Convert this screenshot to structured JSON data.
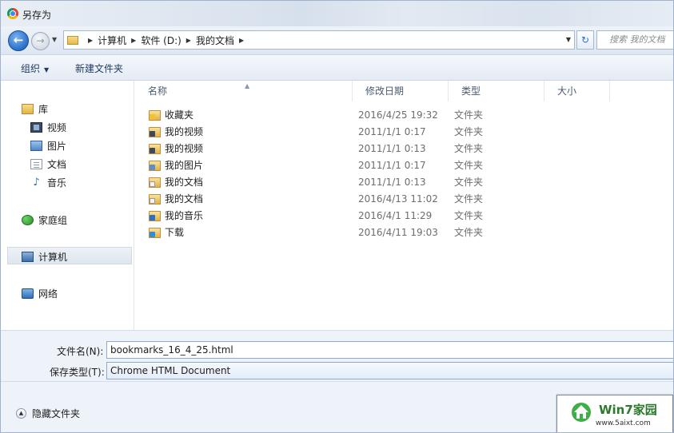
{
  "window": {
    "title": "另存为"
  },
  "navbar": {
    "breadcrumb": [
      "计算机",
      "软件 (D:)",
      "我的文档"
    ],
    "search_placeholder": "搜索 我的文档"
  },
  "toolbar": {
    "organize_label": "组织",
    "new_folder_label": "新建文件夹"
  },
  "sidebar": {
    "library": {
      "label": "库",
      "items": [
        {
          "label": "视频"
        },
        {
          "label": "图片"
        },
        {
          "label": "文档"
        },
        {
          "label": "音乐"
        }
      ]
    },
    "homegroup": {
      "label": "家庭组"
    },
    "computer": {
      "label": "计算机"
    },
    "network": {
      "label": "网络"
    }
  },
  "files": {
    "columns": [
      "名称",
      "修改日期",
      "类型",
      "大小"
    ],
    "rows": [
      {
        "name": "收藏夹",
        "date": "2016/4/25 19:32",
        "type": "文件夹",
        "icon": "favorites-folder-icon"
      },
      {
        "name": "我的视频",
        "date": "2011/1/1 0:17",
        "type": "文件夹",
        "icon": "video-folder-icon"
      },
      {
        "name": "我的视频",
        "date": "2011/1/1 0:13",
        "type": "文件夹",
        "icon": "video-folder-icon"
      },
      {
        "name": "我的图片",
        "date": "2011/1/1 0:17",
        "type": "文件夹",
        "icon": "picture-folder-icon"
      },
      {
        "name": "我的文档",
        "date": "2011/1/1 0:13",
        "type": "文件夹",
        "icon": "document-folder-icon"
      },
      {
        "name": "我的文档",
        "date": "2016/4/13 11:02",
        "type": "文件夹",
        "icon": "document-folder-icon"
      },
      {
        "name": "我的音乐",
        "date": "2016/4/1 11:29",
        "type": "文件夹",
        "icon": "music-folder-icon"
      },
      {
        "name": "下载",
        "date": "2016/4/11 19:03",
        "type": "文件夹",
        "icon": "download-folder-icon"
      }
    ]
  },
  "form": {
    "filename_label": "文件名(N):",
    "filename_value": "bookmarks_16_4_25.html",
    "filetype_label": "保存类型(T):",
    "filetype_value": "Chrome HTML Document"
  },
  "footer": {
    "hide_folders_label": "隐藏文件夹"
  },
  "watermark": {
    "title": "Win7家园",
    "url": "www.5aixt.com"
  }
}
